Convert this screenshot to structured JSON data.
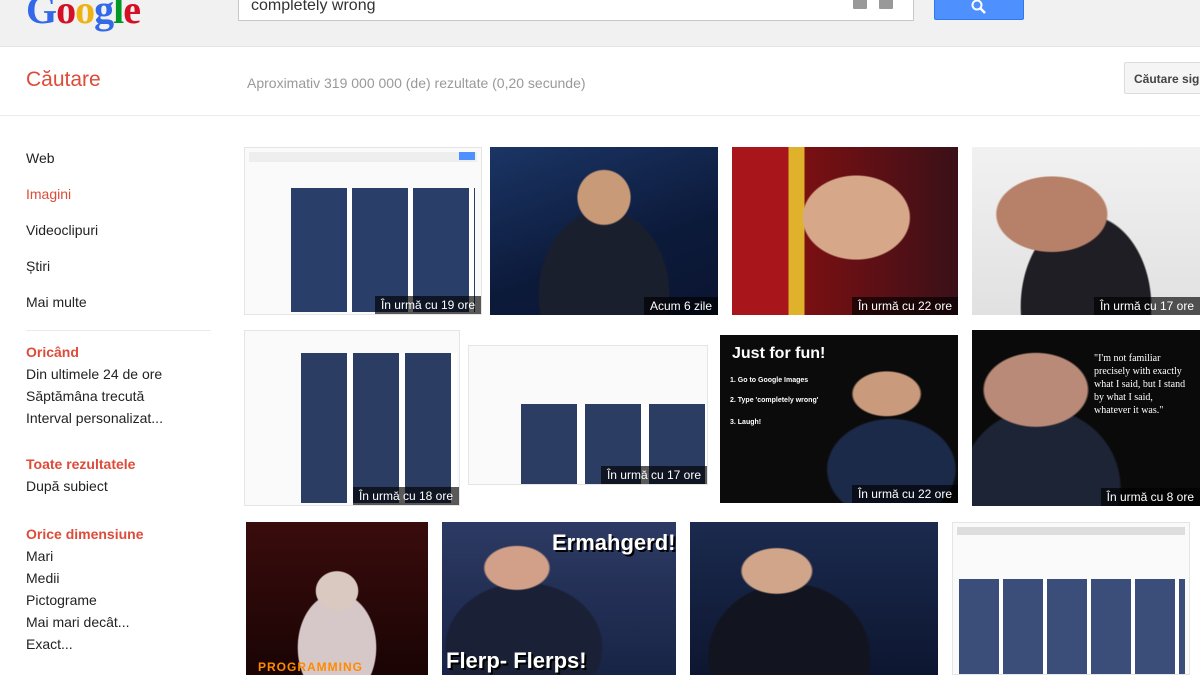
{
  "header": {
    "logo_letters": [
      "G",
      "o",
      "o",
      "g",
      "l",
      "e"
    ],
    "search_value": "completely wrong",
    "search_button_icon": "search-icon"
  },
  "subbar": {
    "title": "Căutare",
    "results_text": "Aproximativ 319 000 000 (de) rezultate (0,20 secunde)",
    "right_button": "Căutare sigură"
  },
  "sidebar": {
    "nav": [
      "Web",
      "Imagini",
      "Videoclipuri",
      "Știri",
      "Mai multe"
    ],
    "active_index": 1,
    "sections": [
      {
        "title": "Oricând",
        "items": [
          "Din ultimele 24 de ore",
          "Săptămâna trecută",
          "Interval personalizat..."
        ]
      },
      {
        "title": "Toate rezultatele",
        "items": [
          "După subiect"
        ]
      },
      {
        "title": "Orice dimensiune",
        "items": [
          "Mari",
          "Medii",
          "Pictograme",
          "Mai mari decât...",
          "Exact..."
        ]
      }
    ]
  },
  "thumbnails": {
    "row1": [
      "În urmă cu 19 ore",
      "Acum 6 zile",
      "În urmă cu 22 ore",
      "În urmă cu 17 ore"
    ],
    "row2": [
      "În urmă cu 18 ore",
      "În urmă cu 17 ore",
      "În urmă cu 22 ore",
      "În urmă cu 8 ore"
    ]
  },
  "memes": {
    "just_for_fun": "Just for fun!",
    "steps": [
      "1. Go to Google Images",
      "2. Type 'completely wrong'",
      "3. Laugh!"
    ],
    "quote": "\"I'm not familiar precisely with exactly what I said, but I stand by what I said, whatever it was.\"",
    "ermahgerd": "Ermahgerd!",
    "flerp": "Flerp- Flerps!",
    "programming": "PROGRAMMING"
  }
}
